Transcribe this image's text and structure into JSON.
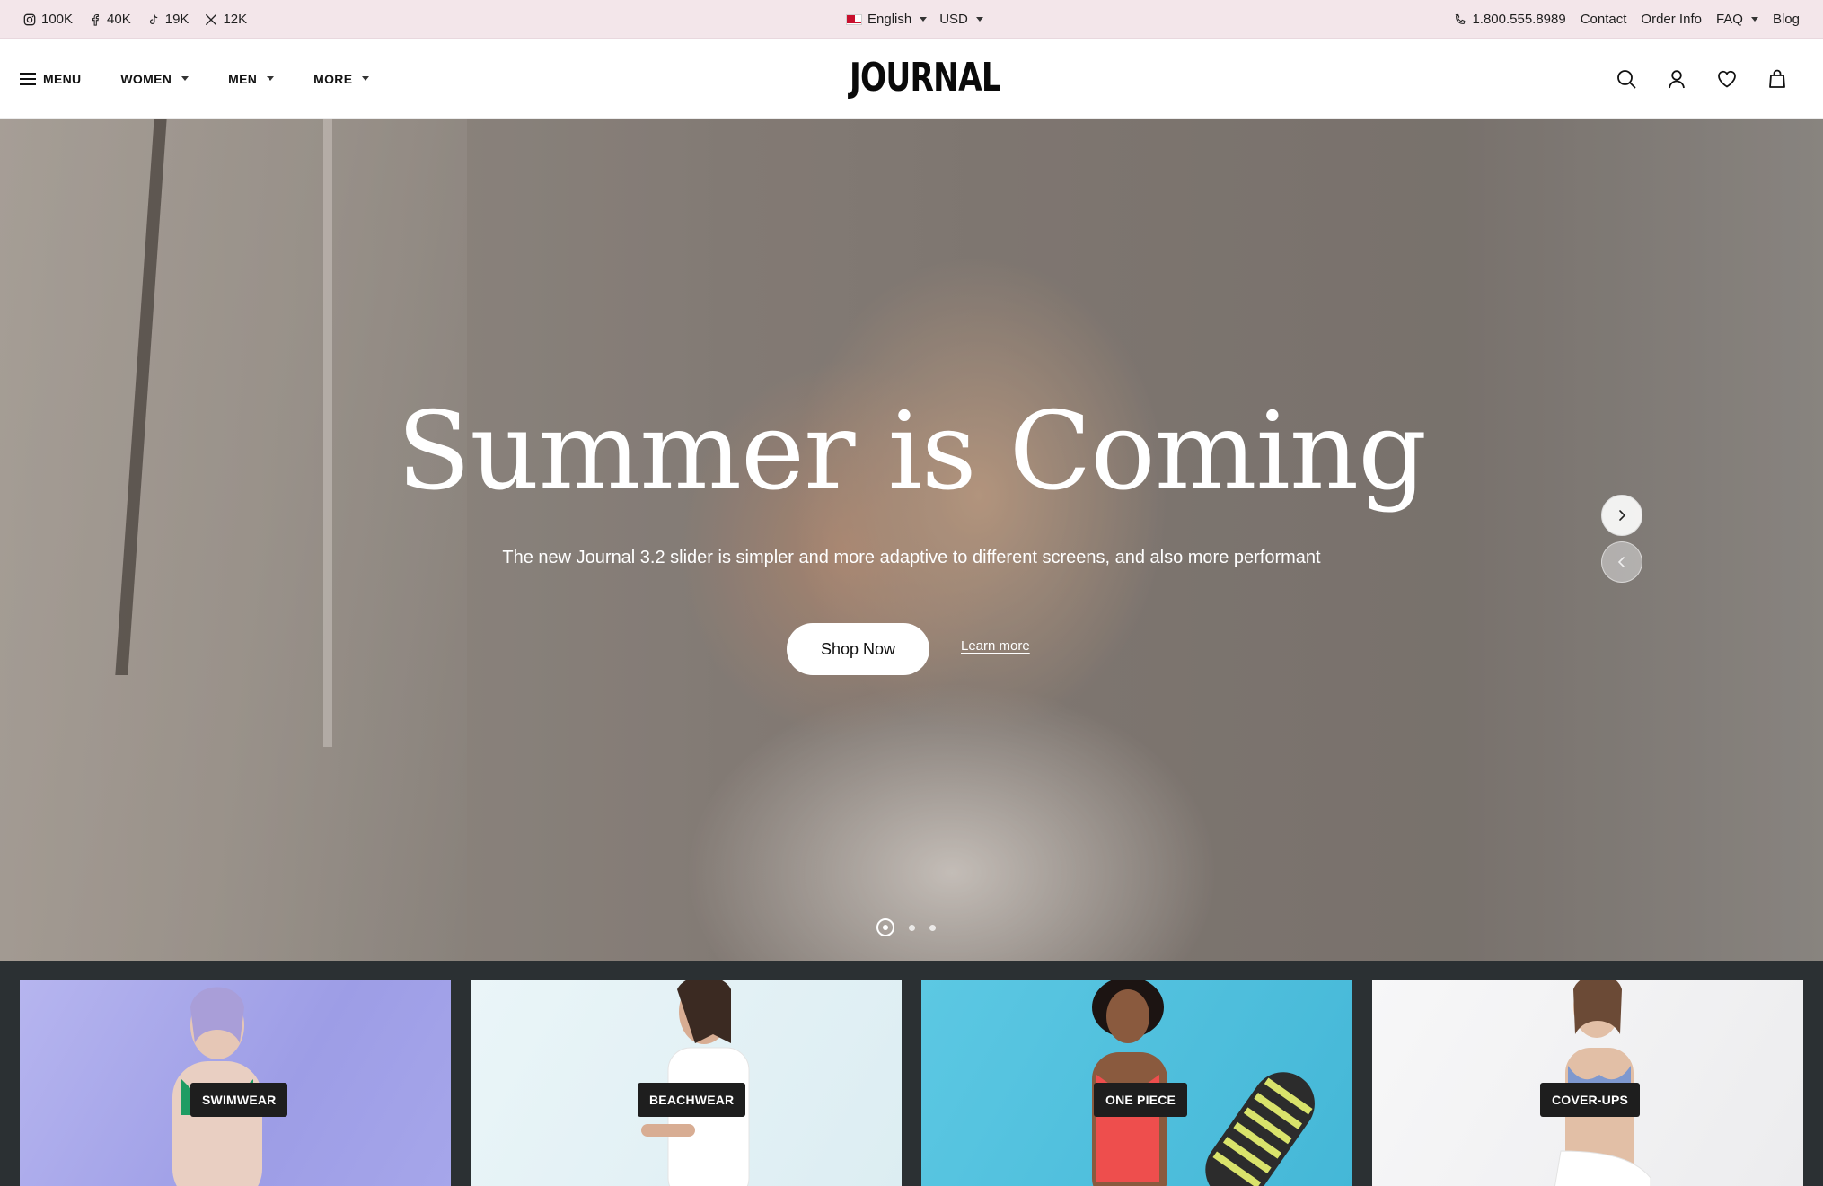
{
  "topbar": {
    "social": [
      {
        "icon": "instagram-icon",
        "count": "100K"
      },
      {
        "icon": "facebook-icon",
        "count": "40K"
      },
      {
        "icon": "tiktok-icon",
        "count": "19K"
      },
      {
        "icon": "x-icon",
        "count": "12K"
      }
    ],
    "language": "English",
    "currency": "USD",
    "phone": "1.800.555.8989",
    "links": {
      "contact": "Contact",
      "order_info": "Order Info",
      "faq": "FAQ",
      "blog": "Blog"
    }
  },
  "header": {
    "menu_label": "MENU",
    "nav": {
      "women": "WOMEN",
      "men": "MEN",
      "more": "MORE"
    },
    "logo": "JOURNAL",
    "icons": [
      "search-icon",
      "account-icon",
      "wishlist-icon",
      "cart-icon"
    ]
  },
  "hero": {
    "title": "Summer is Coming",
    "subtitle": "The new Journal 3.2 slider is simpler and more adaptive to different screens, and also more performant",
    "cta_primary": "Shop Now",
    "cta_secondary": "Learn more",
    "slides_total": 3,
    "active_slide": 1
  },
  "categories": [
    {
      "label": "SWIMWEAR"
    },
    {
      "label": "BEACHWEAR"
    },
    {
      "label": "ONE PIECE"
    },
    {
      "label": "COVER-UPS"
    }
  ],
  "colors": {
    "topbar_bg": "#f3e6ea",
    "category_strip_bg": "#2b3033",
    "label_bg": "#1e1e1e"
  }
}
